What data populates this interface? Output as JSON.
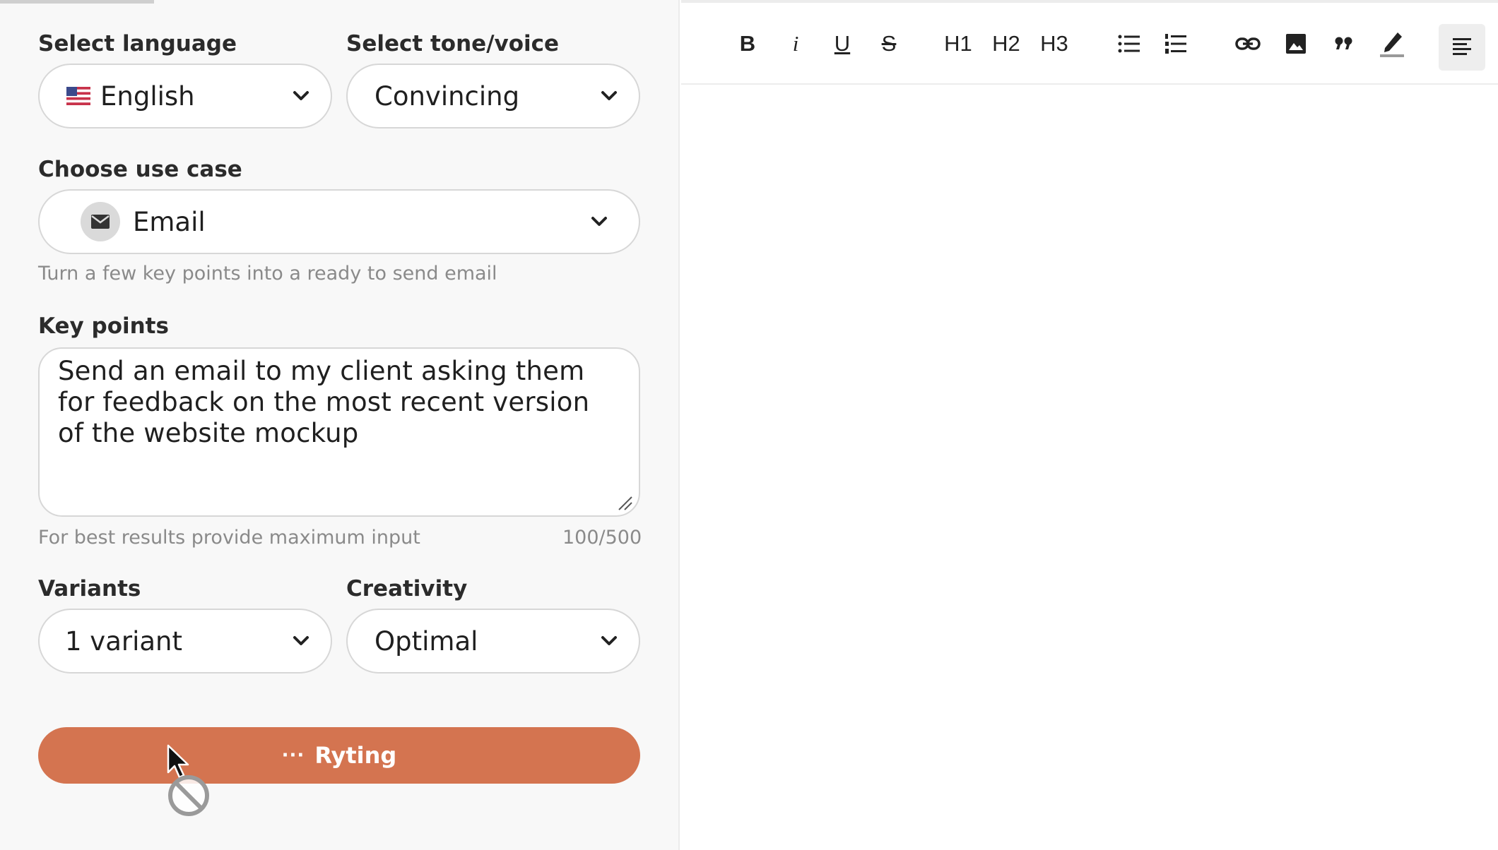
{
  "form": {
    "language": {
      "label": "Select language",
      "value": "English",
      "flag": "us-flag-icon"
    },
    "tone": {
      "label": "Select tone/voice",
      "value": "Convincing"
    },
    "use_case": {
      "label": "Choose use case",
      "value": "Email",
      "icon": "mail-icon",
      "helper": "Turn a few key points into a ready to send email"
    },
    "key_points": {
      "label": "Key points",
      "value": "Send an email to my client asking them for feedback on the most recent version of the website mockup",
      "helper": "For best results provide maximum input",
      "counter": "100/500"
    },
    "variants": {
      "label": "Variants",
      "value": "1 variant"
    },
    "creativity": {
      "label": "Creativity",
      "value": "Optimal"
    },
    "submit": {
      "dots": "···",
      "label": "Ryting",
      "color": "#d47450"
    }
  },
  "toolbar": {
    "bold": "B",
    "italic": "i",
    "underline": "U",
    "strike": "S",
    "h1": "H1",
    "h2": "H2",
    "h3": "H3",
    "icons": [
      "bullet-list-icon",
      "numbered-list-icon",
      "link-icon",
      "image-icon",
      "quote-icon",
      "highlight-pen-icon",
      "align-left-icon"
    ]
  }
}
